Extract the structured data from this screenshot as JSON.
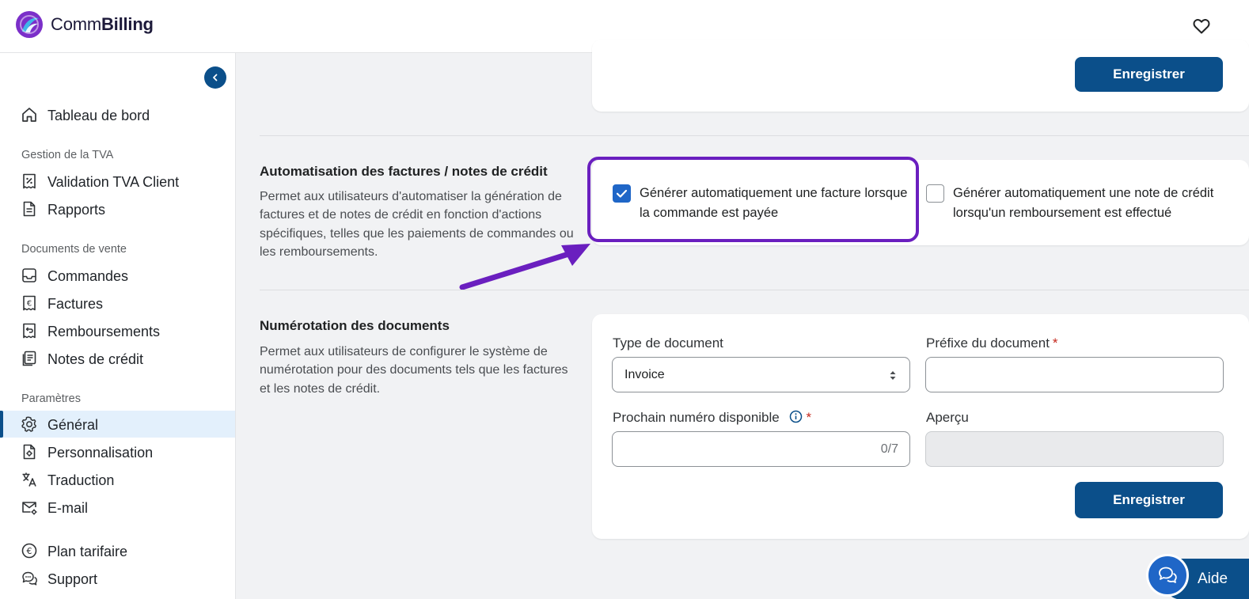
{
  "app": {
    "brand_prefix": "Comm",
    "brand_suffix": "Billing"
  },
  "sidebar": {
    "dashboard": "Tableau de bord",
    "section_vat": "Gestion de la TVA",
    "vat_validation": "Validation TVA Client",
    "reports": "Rapports",
    "section_sales": "Documents de vente",
    "orders": "Commandes",
    "invoices": "Factures",
    "refunds": "Remboursements",
    "credit_notes": "Notes de crédit",
    "section_settings": "Paramètres",
    "general": "Général",
    "customization": "Personnalisation",
    "translation": "Traduction",
    "email": "E-mail",
    "pricing": "Plan tarifaire",
    "support": "Support"
  },
  "top_card": {
    "save_label": "Enregistrer"
  },
  "automation": {
    "title": "Automatisation des factures / notes de crédit",
    "description": "Permet aux utilisateurs d'automatiser la génération de factures et de notes de crédit en fonction d'actions spécifiques, telles que les paiements de commandes ou les remboursements.",
    "option_invoice_label": "Générer automatiquement une facture lorsque la commande est payée",
    "option_invoice_checked": true,
    "option_credit_label": "Générer automatiquement une note de crédit lorsqu'un remboursement est effectué",
    "option_credit_checked": false
  },
  "numbering": {
    "title": "Numérotation des documents",
    "description": "Permet aux utilisateurs de configurer le système de numérotation pour des documents tels que les factures et les notes de crédit.",
    "doc_type_label": "Type de document",
    "doc_type_value": "Invoice",
    "prefix_label": "Préfixe du document",
    "required_mark": "*",
    "next_number_label": "Prochain numéro disponible",
    "next_number_counter": "0/7",
    "preview_label": "Aperçu",
    "save_label": "Enregistrer"
  },
  "help": {
    "label": "Aide"
  },
  "colors": {
    "primary": "#0b4f8a",
    "checkbox": "#1f66c7",
    "annotation": "#6a1fbf",
    "required": "#c5281c"
  }
}
